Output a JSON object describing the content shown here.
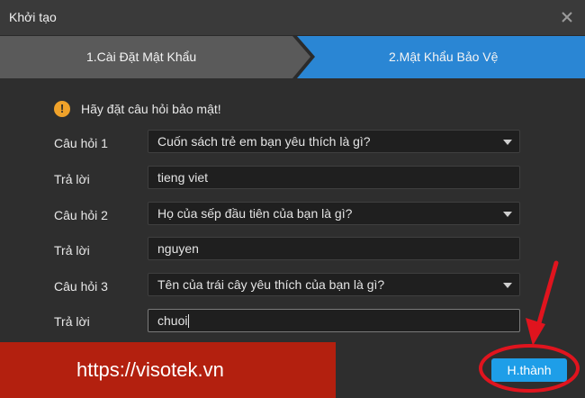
{
  "window": {
    "title": "Khởi tạo"
  },
  "steps": [
    {
      "label": "1.Cài Đặt Mật Khẩu",
      "active": false
    },
    {
      "label": "2.Mật Khẩu Bảo Vệ",
      "active": true
    }
  ],
  "hint": {
    "icon": "warning-icon",
    "text": "Hãy đặt câu hỏi bảo mật!"
  },
  "form": {
    "question1_label": "Câu hỏi 1",
    "question1_value": "Cuốn sách trẻ em bạn yêu thích là gì?",
    "answer1_label": "Trả lời",
    "answer1_value": "tieng viet",
    "question2_label": "Câu hỏi 2",
    "question2_value": "Họ của sếp đầu tiên của bạn là gì?",
    "answer2_label": "Trả lời",
    "answer2_value": "nguyen",
    "question3_label": "Câu hỏi 3",
    "question3_value": "Tên của trái cây yêu thích của bạn là gì?",
    "answer3_label": "Trả lời",
    "answer3_value": "chuoi"
  },
  "footer": {
    "finish_label": "H.thành",
    "watermark": "https://visotek.vn"
  },
  "colors": {
    "accent": "#1e9ee8",
    "banner": "#b3200f",
    "annotation": "#e0141e"
  }
}
